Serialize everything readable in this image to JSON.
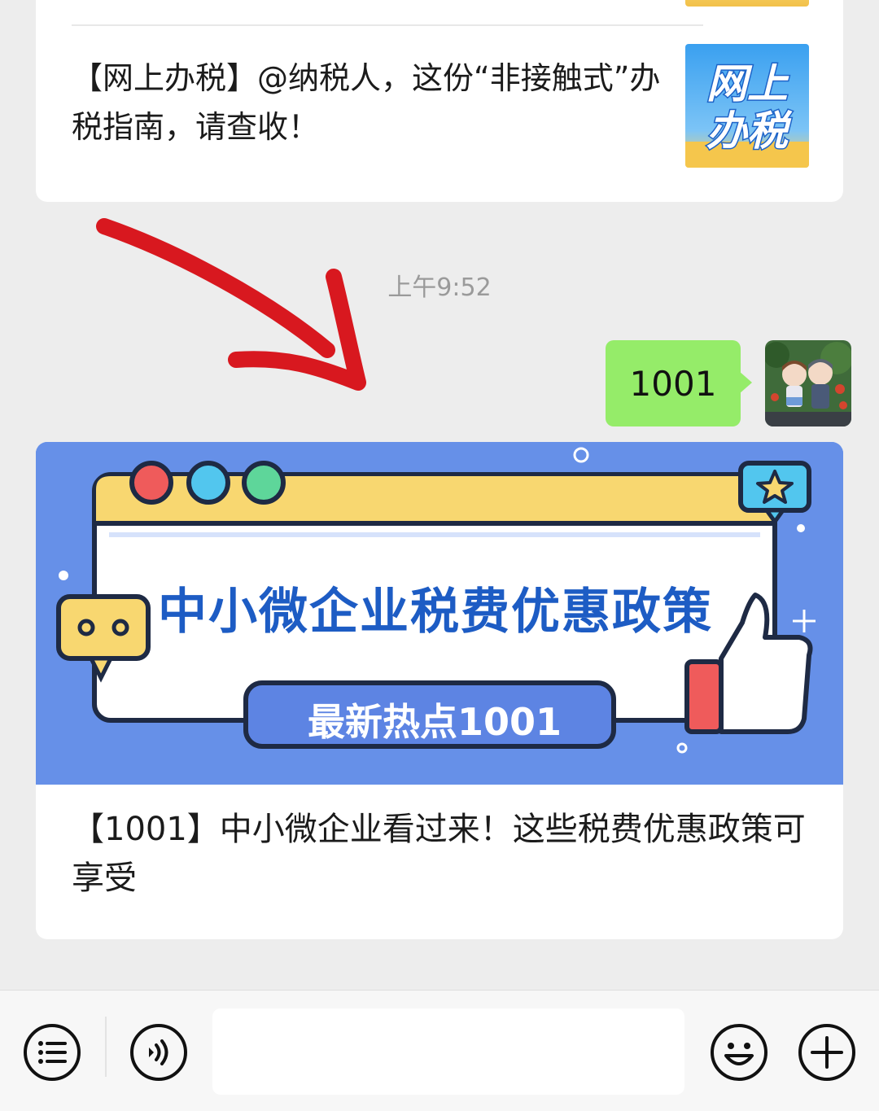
{
  "article_top": {
    "title": "【网上办税】@纳税人，这份“非接触式”办税指南，请查收！",
    "thumb_text_line1": "网上",
    "thumb_text_line2": "办税"
  },
  "chat": {
    "timestamp": "上午9:52",
    "sent_message": "1001",
    "bubble_color": "#95ec69"
  },
  "article_main": {
    "banner_headline": "中小微企业税费优惠政策",
    "banner_tag": "最新热点1001",
    "title": "【1001】中小微企业看过来！这些税费优惠政策可享受",
    "banner_color": "#6690e8"
  },
  "input_bar": {
    "menu_icon": "list-menu-icon",
    "voice_icon": "voice-icon",
    "emoji_icon": "emoji-icon",
    "plus_icon": "plus-icon",
    "placeholder": ""
  },
  "annotation": {
    "arrow_color": "#d8181f"
  }
}
